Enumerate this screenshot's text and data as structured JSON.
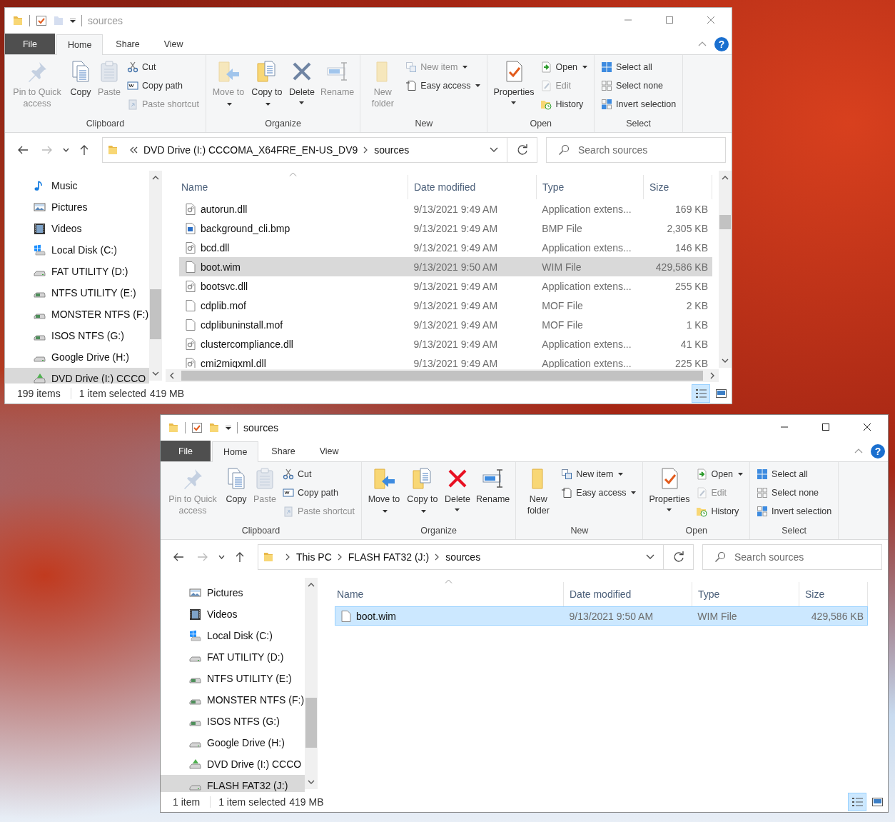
{
  "windows": [
    {
      "active": false,
      "title": "sources",
      "help": "?",
      "tabs": [
        {
          "label": "File",
          "kind": "file",
          "selected": false
        },
        {
          "label": "Home",
          "kind": "tab",
          "selected": true
        },
        {
          "label": "Share",
          "kind": "tab",
          "selected": false
        },
        {
          "label": "View",
          "kind": "tab",
          "selected": false
        }
      ],
      "ribbon": [
        {
          "label": "Clipboard",
          "items": [
            {
              "kind": "large",
              "label": "Pin to Quick access",
              "disabled": true,
              "dropdown": false
            },
            {
              "kind": "large",
              "label": "Copy",
              "disabled": false,
              "dropdown": false
            },
            {
              "kind": "large",
              "label": "Paste",
              "disabled": true,
              "dropdown": false
            },
            {
              "kind": "small",
              "label": "Cut",
              "disabled": false,
              "dropdown": false
            },
            {
              "kind": "small",
              "label": "Copy path",
              "disabled": false,
              "dropdown": false
            },
            {
              "kind": "small",
              "label": "Paste shortcut",
              "disabled": true,
              "dropdown": false
            }
          ]
        },
        {
          "label": "Organize",
          "items": [
            {
              "kind": "large",
              "label": "Move to",
              "disabled": true,
              "dropdown": true
            },
            {
              "kind": "large",
              "label": "Copy to",
              "disabled": false,
              "dropdown": true
            },
            {
              "kind": "large",
              "label": "Delete",
              "disabled": false,
              "dropdown": true
            },
            {
              "kind": "large",
              "label": "Rename",
              "disabled": true,
              "dropdown": false
            }
          ]
        },
        {
          "label": "New",
          "items": [
            {
              "kind": "large",
              "label": "New folder",
              "disabled": true,
              "dropdown": false
            },
            {
              "kind": "small",
              "label": "New item",
              "disabled": true,
              "dropdown": true
            },
            {
              "kind": "small",
              "label": "Easy access",
              "disabled": false,
              "dropdown": true
            }
          ]
        },
        {
          "label": "Open",
          "items": [
            {
              "kind": "large",
              "label": "Properties",
              "disabled": false,
              "dropdown": true
            },
            {
              "kind": "small",
              "label": "Open",
              "disabled": false,
              "dropdown": true
            },
            {
              "kind": "small",
              "label": "Edit",
              "disabled": true,
              "dropdown": false
            },
            {
              "kind": "small",
              "label": "History",
              "disabled": false,
              "dropdown": false
            }
          ]
        },
        {
          "label": "Select",
          "items": [
            {
              "kind": "small",
              "label": "Select all",
              "disabled": false,
              "dropdown": false
            },
            {
              "kind": "small",
              "label": "Select none",
              "disabled": false,
              "dropdown": false
            },
            {
              "kind": "small",
              "label": "Invert selection",
              "disabled": false,
              "dropdown": false
            }
          ]
        }
      ],
      "address": {
        "overflow": true,
        "crumbs": [
          "DVD Drive (I:) CCCOMA_X64FRE_EN-US_DV9",
          "sources"
        ]
      },
      "search": {
        "placeholder": "Search sources"
      },
      "nav": [
        {
          "label": "Music",
          "kind": "music",
          "selected": false
        },
        {
          "label": "Pictures",
          "kind": "pictures",
          "selected": false
        },
        {
          "label": "Videos",
          "kind": "videos",
          "selected": false
        },
        {
          "label": "Local Disk (C:)",
          "kind": "system",
          "selected": false
        },
        {
          "label": "FAT UTILITY (D:)",
          "kind": "drive",
          "selected": false
        },
        {
          "label": "NTFS UTILITY (E:)",
          "kind": "removable",
          "selected": false
        },
        {
          "label": "MONSTER NTFS (F:)",
          "kind": "removable",
          "selected": false
        },
        {
          "label": "ISOS NTFS (G:)",
          "kind": "removable",
          "selected": false
        },
        {
          "label": "Google Drive (H:)",
          "kind": "drive",
          "selected": false
        },
        {
          "label": "DVD Drive (I:) CCCO",
          "kind": "dvd",
          "selected": true
        }
      ],
      "columns": [
        {
          "label": "Name",
          "sorted": true
        },
        {
          "label": "Date modified",
          "sorted": false
        },
        {
          "label": "Type",
          "sorted": false
        },
        {
          "label": "Size",
          "sorted": false
        }
      ],
      "rows": [
        {
          "kind": "dll",
          "name": "autorun.dll",
          "date": "9/13/2021 9:49 AM",
          "type": "Application extens...",
          "size": "169 KB",
          "selected": false
        },
        {
          "kind": "bmp",
          "name": "background_cli.bmp",
          "date": "9/13/2021 9:49 AM",
          "type": "BMP File",
          "size": "2,305 KB",
          "selected": false
        },
        {
          "kind": "dll",
          "name": "bcd.dll",
          "date": "9/13/2021 9:49 AM",
          "type": "Application extens...",
          "size": "146 KB",
          "selected": false
        },
        {
          "kind": "file",
          "name": "boot.wim",
          "date": "9/13/2021 9:50 AM",
          "type": "WIM File",
          "size": "429,586 KB",
          "selected": true
        },
        {
          "kind": "dll",
          "name": "bootsvc.dll",
          "date": "9/13/2021 9:49 AM",
          "type": "Application extens...",
          "size": "255 KB",
          "selected": false
        },
        {
          "kind": "file",
          "name": "cdplib.mof",
          "date": "9/13/2021 9:49 AM",
          "type": "MOF File",
          "size": "2 KB",
          "selected": false
        },
        {
          "kind": "file",
          "name": "cdplibuninstall.mof",
          "date": "9/13/2021 9:49 AM",
          "type": "MOF File",
          "size": "1 KB",
          "selected": false
        },
        {
          "kind": "dll",
          "name": "clustercompliance.dll",
          "date": "9/13/2021 9:49 AM",
          "type": "Application extens...",
          "size": "41 KB",
          "selected": false
        },
        {
          "kind": "dll",
          "name": "cmi2migxml.dll",
          "date": "9/13/2021 9:49 AM",
          "type": "Application extens...",
          "size": "225 KB",
          "selected": false
        }
      ],
      "status": {
        "count": "199 items",
        "selection": "1 item selected",
        "size": "419 MB"
      },
      "views": [
        {
          "selected": true
        },
        {
          "selected": false
        }
      ]
    },
    {
      "active": true,
      "title": "sources",
      "help": "?",
      "tabs": [
        {
          "label": "File",
          "kind": "file",
          "selected": false
        },
        {
          "label": "Home",
          "kind": "tab",
          "selected": true
        },
        {
          "label": "Share",
          "kind": "tab",
          "selected": false
        },
        {
          "label": "View",
          "kind": "tab",
          "selected": false
        }
      ],
      "ribbon": [
        {
          "label": "Clipboard",
          "items": [
            {
              "kind": "large",
              "label": "Pin to Quick access",
              "disabled": true,
              "dropdown": false
            },
            {
              "kind": "large",
              "label": "Copy",
              "disabled": false,
              "dropdown": false
            },
            {
              "kind": "large",
              "label": "Paste",
              "disabled": true,
              "dropdown": false
            },
            {
              "kind": "small",
              "label": "Cut",
              "disabled": false,
              "dropdown": false
            },
            {
              "kind": "small",
              "label": "Copy path",
              "disabled": false,
              "dropdown": false
            },
            {
              "kind": "small",
              "label": "Paste shortcut",
              "disabled": true,
              "dropdown": false
            }
          ]
        },
        {
          "label": "Organize",
          "items": [
            {
              "kind": "large",
              "label": "Move to",
              "disabled": false,
              "dropdown": true
            },
            {
              "kind": "large",
              "label": "Copy to",
              "disabled": false,
              "dropdown": true
            },
            {
              "kind": "large",
              "label": "Delete",
              "disabled": false,
              "dropdown": true
            },
            {
              "kind": "large",
              "label": "Rename",
              "disabled": false,
              "dropdown": false
            }
          ]
        },
        {
          "label": "New",
          "items": [
            {
              "kind": "large",
              "label": "New folder",
              "disabled": false,
              "dropdown": false
            },
            {
              "kind": "small",
              "label": "New item",
              "disabled": false,
              "dropdown": true
            },
            {
              "kind": "small",
              "label": "Easy access",
              "disabled": false,
              "dropdown": true
            }
          ]
        },
        {
          "label": "Open",
          "items": [
            {
              "kind": "large",
              "label": "Properties",
              "disabled": false,
              "dropdown": true
            },
            {
              "kind": "small",
              "label": "Open",
              "disabled": false,
              "dropdown": true
            },
            {
              "kind": "small",
              "label": "Edit",
              "disabled": true,
              "dropdown": false
            },
            {
              "kind": "small",
              "label": "History",
              "disabled": false,
              "dropdown": false
            }
          ]
        },
        {
          "label": "Select",
          "items": [
            {
              "kind": "small",
              "label": "Select all",
              "disabled": false,
              "dropdown": false
            },
            {
              "kind": "small",
              "label": "Select none",
              "disabled": false,
              "dropdown": false
            },
            {
              "kind": "small",
              "label": "Invert selection",
              "disabled": false,
              "dropdown": false
            }
          ]
        }
      ],
      "address": {
        "overflow": false,
        "crumbs": [
          "This PC",
          "FLASH FAT32 (J:)",
          "sources"
        ]
      },
      "search": {
        "placeholder": "Search sources"
      },
      "nav": [
        {
          "label": "Pictures",
          "kind": "pictures",
          "selected": false
        },
        {
          "label": "Videos",
          "kind": "videos",
          "selected": false
        },
        {
          "label": "Local Disk (C:)",
          "kind": "system",
          "selected": false
        },
        {
          "label": "FAT UTILITY (D:)",
          "kind": "drive",
          "selected": false
        },
        {
          "label": "NTFS UTILITY (E:)",
          "kind": "removable",
          "selected": false
        },
        {
          "label": "MONSTER NTFS (F:)",
          "kind": "removable",
          "selected": false
        },
        {
          "label": "ISOS NTFS (G:)",
          "kind": "removable",
          "selected": false
        },
        {
          "label": "Google Drive (H:)",
          "kind": "drive",
          "selected": false
        },
        {
          "label": "DVD Drive (I:) CCCO",
          "kind": "dvd",
          "selected": false
        },
        {
          "label": "FLASH FAT32 (J:)",
          "kind": "drive",
          "selected": true
        }
      ],
      "columns": [
        {
          "label": "Name",
          "sorted": true
        },
        {
          "label": "Date modified",
          "sorted": false
        },
        {
          "label": "Type",
          "sorted": false
        },
        {
          "label": "Size",
          "sorted": false
        }
      ],
      "rows": [
        {
          "kind": "file",
          "name": "boot.wim",
          "date": "9/13/2021 9:50 AM",
          "type": "WIM File",
          "size": "429,586 KB",
          "selected": true
        }
      ],
      "status": {
        "count": "1 item",
        "selection": "1 item selected",
        "size": "419 MB"
      },
      "views": [
        {
          "selected": true
        },
        {
          "selected": false
        }
      ]
    }
  ]
}
